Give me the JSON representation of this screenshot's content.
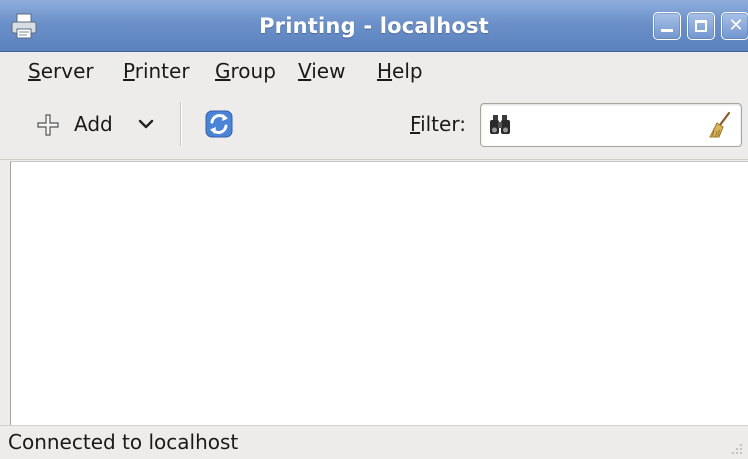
{
  "window": {
    "title": "Printing - localhost",
    "app_icon": "printer-icon",
    "controls": [
      "minimize-icon",
      "maximize-icon",
      "close-icon"
    ],
    "close_glyph": "✕"
  },
  "menubar": {
    "items": [
      {
        "mnemonic": "S",
        "rest": "erver"
      },
      {
        "mnemonic": "P",
        "rest": "rinter"
      },
      {
        "mnemonic": "G",
        "rest": "roup"
      },
      {
        "mnemonic": "V",
        "rest": "iew"
      },
      {
        "mnemonic": "H",
        "rest": "elp"
      }
    ]
  },
  "toolbar": {
    "add_label": "Add",
    "add_icon": "plus-icon",
    "dropdown_icon": "chevron-down-icon",
    "refresh_icon": "refresh-icon",
    "filter": {
      "mnemonic": "F",
      "rest": "ilter:",
      "value": "",
      "search_icon": "binoculars-icon",
      "clear_icon": "broom-icon"
    }
  },
  "statusbar": {
    "text": "Connected to localhost"
  },
  "colors": {
    "titlebar": "#6b90c8",
    "window_bg": "#edeceb",
    "list_bg": "#ffffff"
  }
}
